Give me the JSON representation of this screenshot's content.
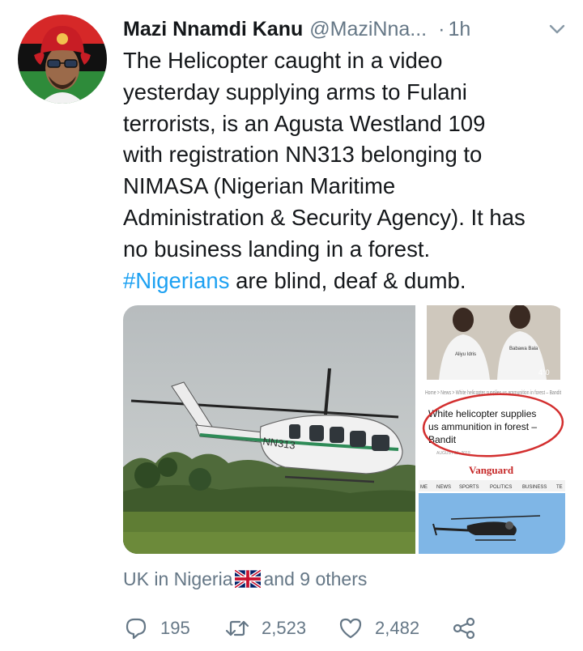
{
  "tweet": {
    "author_name": "Mazi Nnamdi Kanu",
    "author_handle": "@MaziNna...",
    "separator": "·",
    "timestamp": "1h",
    "text_lines": [
      "The Helicopter caught in a video",
      "yesterday supplying arms to Fulani",
      "terrorists, is an Agusta Westland 109",
      "with registration NN313 belonging to",
      "NIMASA (Nigerian Maritime",
      "Administration & Security Agency). It has",
      "no business landing in a forest."
    ],
    "hashtag": "#Nigerians",
    "text_tail": " are blind, deaf & dumb.",
    "social_context_prefix": "UK in Nigeria",
    "social_context_suffix": " and 9 others"
  },
  "media": {
    "helicopter_registration": "NN313",
    "clip_top": {
      "person_left_shirt": "Aliyu Idris",
      "person_right_shirt": "Babawa Bala",
      "count_badge": "4°0",
      "breadcrumb": "Home > News > White helicopter supplies us ammunition in forest – Bandit",
      "headline_line1": "White helicopter supplies",
      "headline_line2": "us ammunition in forest –",
      "headline_line3": "Bandit",
      "date": "AUGUST 21, 2019"
    },
    "clip_bottom": {
      "brand": "Vanguard",
      "nav": [
        "ME",
        "NEWS",
        "SPORTS",
        "POLITICS",
        "BUSINESS",
        "TE"
      ]
    }
  },
  "actions": {
    "replies": "195",
    "retweets": "2,523",
    "likes": "2,482"
  },
  "colors": {
    "text": "#14171a",
    "muted": "#657786",
    "link": "#1da1f2"
  },
  "icons": [
    "chevron-down-icon",
    "reply-icon",
    "retweet-icon",
    "like-icon",
    "share-icon",
    "uk-flag-icon"
  ]
}
